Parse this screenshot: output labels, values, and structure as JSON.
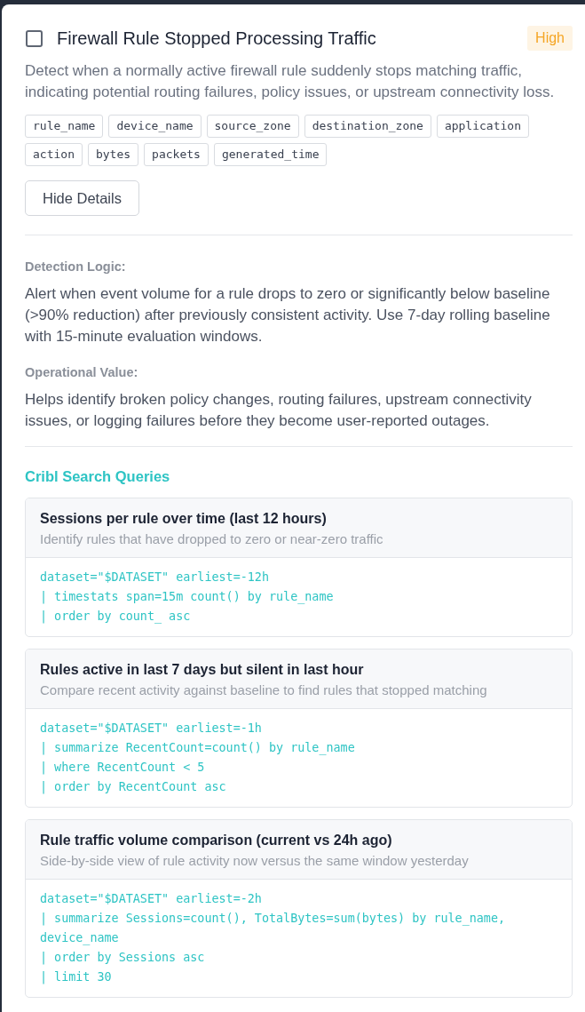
{
  "rule": {
    "checked": false,
    "title": "Firewall Rule Stopped Processing Traffic",
    "severity": "High",
    "description": "Detect when a normally active firewall rule suddenly stops matching traffic, indicating potential routing failures, policy issues, or upstream connectivity loss.",
    "fields": [
      "rule_name",
      "device_name",
      "source_zone",
      "destination_zone",
      "application",
      "action",
      "bytes",
      "packets",
      "generated_time"
    ],
    "details_button": "Hide Details"
  },
  "details": [
    {
      "label": "Detection Logic:",
      "text": "Alert when event volume for a rule drops to zero or significantly below baseline (>90% reduction) after previously consistent activity. Use 7-day rolling baseline with 15-minute evaluation windows."
    },
    {
      "label": "Operational Value:",
      "text": "Helps identify broken policy changes, routing failures, upstream connectivity issues, or logging failures before they become user-reported outages."
    }
  ],
  "queries_section": {
    "title": "Cribl Search Queries",
    "queries": [
      {
        "title": "Sessions per rule over time (last 12 hours)",
        "description": "Identify rules that have dropped to zero or near-zero traffic",
        "code": [
          "dataset=\"$DATASET\" earliest=-12h",
          "| timestats span=15m count() by rule_name",
          "| order by count_ asc"
        ]
      },
      {
        "title": "Rules active in last 7 days but silent in last hour",
        "description": "Compare recent activity against baseline to find rules that stopped matching",
        "code": [
          "dataset=\"$DATASET\" earliest=-1h",
          "| summarize RecentCount=count() by rule_name",
          "| where RecentCount < 5",
          "| order by RecentCount asc"
        ]
      },
      {
        "title": "Rule traffic volume comparison (current vs 24h ago)",
        "description": "Side-by-side view of rule activity now versus the same window yesterday",
        "code": [
          "dataset=\"$DATASET\" earliest=-2h",
          "| summarize Sessions=count(), TotalBytes=sum(bytes) by rule_name, device_name",
          "| order by Sessions asc",
          "| limit 30"
        ]
      }
    ]
  }
}
